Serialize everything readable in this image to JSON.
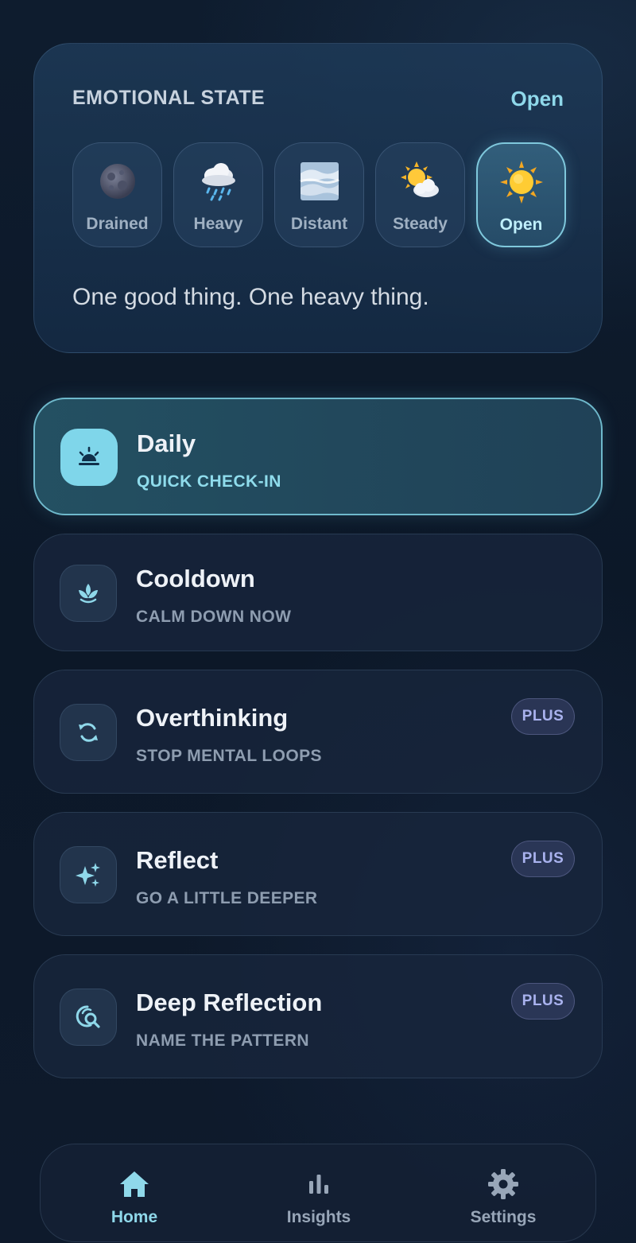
{
  "mood": {
    "title": "EMOTIONAL STATE",
    "selected": "Open",
    "options": [
      {
        "label": "Drained",
        "icon": "moon-icon"
      },
      {
        "label": "Heavy",
        "icon": "rain-cloud-icon"
      },
      {
        "label": "Distant",
        "icon": "fog-icon"
      },
      {
        "label": "Steady",
        "icon": "sun-behind-cloud-icon"
      },
      {
        "label": "Open",
        "icon": "sun-icon"
      }
    ],
    "prompt": "One good thing. One heavy thing."
  },
  "activities": [
    {
      "name": "Daily",
      "subtitle": "QUICK CHECK-IN",
      "icon": "sunrise-icon",
      "badge": ""
    },
    {
      "name": "Cooldown",
      "subtitle": "CALM DOWN NOW",
      "icon": "lotus-icon",
      "badge": ""
    },
    {
      "name": "Overthinking",
      "subtitle": "STOP MENTAL LOOPS",
      "icon": "refresh-icon",
      "badge": "PLUS"
    },
    {
      "name": "Reflect",
      "subtitle": "GO A LITTLE DEEPER",
      "icon": "sparkles-icon",
      "badge": "PLUS"
    },
    {
      "name": "Deep Reflection",
      "subtitle": "NAME THE PATTERN",
      "icon": "search-pattern-icon",
      "badge": "PLUS"
    }
  ],
  "nav": {
    "items": [
      {
        "label": "Home",
        "icon": "home-icon"
      },
      {
        "label": "Insights",
        "icon": "bar-chart-icon"
      },
      {
        "label": "Settings",
        "icon": "gear-icon"
      }
    ],
    "active": "Home"
  },
  "colors": {
    "accent": "#8fd8ea",
    "background": "#0d1a2b",
    "plus_badge": "#a9b2ee"
  }
}
